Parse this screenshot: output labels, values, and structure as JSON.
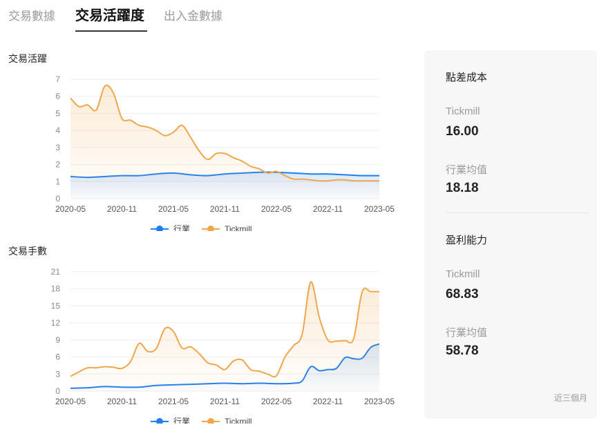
{
  "tabs": [
    {
      "label": "交易數據",
      "active": false
    },
    {
      "label": "交易活躍度",
      "active": true
    },
    {
      "label": "出入金數據",
      "active": false
    }
  ],
  "colors": {
    "industry": "#1f7ff0",
    "tickmill": "#f0a64a"
  },
  "charts": {
    "activity": {
      "title": "交易活躍"
    },
    "lots": {
      "title": "交易手數"
    }
  },
  "chart_data": [
    {
      "type": "area",
      "title": "交易活躍",
      "xlabel": "",
      "ylabel": "",
      "ylim": [
        0,
        7
      ],
      "yticks": [
        "0",
        "1",
        "2",
        "3",
        "4",
        "5",
        "6",
        "7"
      ],
      "xticks": [
        "2020-05",
        "2020-11",
        "2021-05",
        "2021-11",
        "2022-05",
        "2022-11",
        "2023-05"
      ],
      "x_range": [
        0,
        36
      ],
      "grid": true,
      "legend_position": "bottom-center",
      "series": [
        {
          "name": "行業",
          "x": [
            0,
            2,
            4,
            6,
            8,
            10,
            12,
            14,
            16,
            18,
            20,
            22,
            24,
            26,
            28,
            30,
            32,
            34,
            36
          ],
          "values": [
            1.3,
            1.25,
            1.3,
            1.35,
            1.35,
            1.45,
            1.5,
            1.4,
            1.35,
            1.45,
            1.5,
            1.55,
            1.55,
            1.5,
            1.45,
            1.45,
            1.4,
            1.35,
            1.35
          ]
        },
        {
          "name": "Tickmill",
          "x": [
            0,
            1,
            2,
            3,
            4,
            5,
            6,
            7,
            8,
            9,
            10,
            11,
            12,
            13,
            14,
            15,
            16,
            17,
            18,
            19,
            20,
            21,
            22,
            23,
            24,
            25,
            26,
            27,
            28,
            29,
            30,
            31,
            32,
            33,
            34,
            35,
            36
          ],
          "values": [
            5.9,
            5.4,
            5.5,
            5.2,
            6.6,
            6.2,
            4.7,
            4.6,
            4.3,
            4.2,
            4.0,
            3.7,
            3.9,
            4.3,
            3.6,
            2.8,
            2.3,
            2.65,
            2.65,
            2.4,
            2.2,
            1.9,
            1.75,
            1.5,
            1.6,
            1.35,
            1.15,
            1.15,
            1.1,
            1.05,
            1.05,
            1.1,
            1.1,
            1.05,
            1.05,
            1.05,
            1.05
          ]
        }
      ]
    },
    {
      "type": "area",
      "title": "交易手數",
      "xlabel": "",
      "ylabel": "",
      "ylim": [
        0,
        21
      ],
      "yticks": [
        "0",
        "3",
        "6",
        "9",
        "12",
        "15",
        "18",
        "21"
      ],
      "xticks": [
        "2020-05",
        "2020-11",
        "2021-05",
        "2021-11",
        "2022-05",
        "2022-11",
        "2023-05"
      ],
      "x_range": [
        0,
        36
      ],
      "grid": true,
      "legend_position": "bottom-center",
      "series": [
        {
          "name": "行業",
          "x": [
            0,
            2,
            4,
            6,
            8,
            10,
            12,
            14,
            16,
            18,
            20,
            22,
            24,
            26,
            27,
            28,
            29,
            30,
            31,
            32,
            33,
            34,
            35,
            36
          ],
          "values": [
            0.5,
            0.6,
            0.8,
            0.7,
            0.7,
            1.0,
            1.1,
            1.2,
            1.3,
            1.4,
            1.3,
            1.4,
            1.3,
            1.4,
            1.8,
            4.3,
            3.6,
            3.8,
            4.0,
            5.9,
            5.7,
            5.8,
            7.7,
            8.3
          ]
        },
        {
          "name": "Tickmill",
          "x": [
            0,
            1,
            2,
            3,
            4,
            5,
            6,
            7,
            8,
            9,
            10,
            11,
            12,
            13,
            14,
            15,
            16,
            17,
            18,
            19,
            20,
            21,
            22,
            23,
            24,
            25,
            26,
            27,
            28,
            29,
            30,
            31,
            32,
            33,
            34,
            35,
            36
          ],
          "values": [
            2.6,
            3.4,
            4.1,
            4.1,
            4.3,
            4.2,
            4.0,
            5.2,
            8.4,
            7.0,
            7.5,
            11.0,
            10.5,
            7.6,
            7.8,
            6.6,
            5.0,
            4.6,
            3.8,
            5.3,
            5.5,
            3.8,
            3.5,
            3.0,
            2.7,
            6.0,
            8.0,
            10.0,
            19.2,
            13.0,
            9.0,
            8.8,
            8.9,
            9.2,
            17.5,
            17.5,
            17.5
          ]
        }
      ]
    }
  ],
  "side_panel": {
    "spread_cost": {
      "title": "點差成本",
      "tickmill_label": "Tickmill",
      "tickmill_value": "16.00",
      "industry_label": "行業均值",
      "industry_value": "18.18"
    },
    "profitability": {
      "title": "盈利能力",
      "tickmill_label": "Tickmill",
      "tickmill_value": "68.83",
      "industry_label": "行業均值",
      "industry_value": "58.78"
    },
    "footnote": "近三個月"
  }
}
